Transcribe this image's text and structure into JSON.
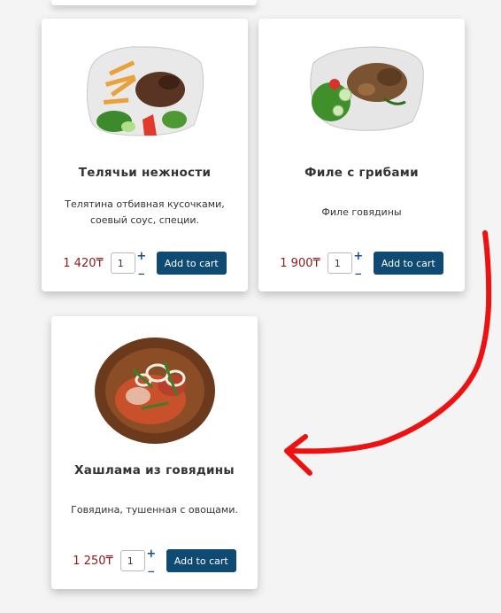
{
  "cart": {
    "add_label": "Add to cart"
  },
  "products": [
    {
      "title": "Телячьи нежности",
      "description": "Телятина отбивная кусочками, соевый соус, специи.",
      "price": "1 420₸",
      "quantity": "1"
    },
    {
      "title": "Филе с грибами",
      "description": "Филе говядины",
      "price": "1 900₸",
      "quantity": "1"
    },
    {
      "title": "Хашлама из говядины",
      "description": "Говядина, тушенная с овощами.",
      "price": "1 250₸",
      "quantity": "1"
    }
  ],
  "colors": {
    "price": "#8b1a1a",
    "button": "#0f4a73",
    "stepper": "#1a4f8a",
    "arrow": "#ee1111"
  },
  "icons": {
    "increment": "+",
    "decrement": "_"
  }
}
